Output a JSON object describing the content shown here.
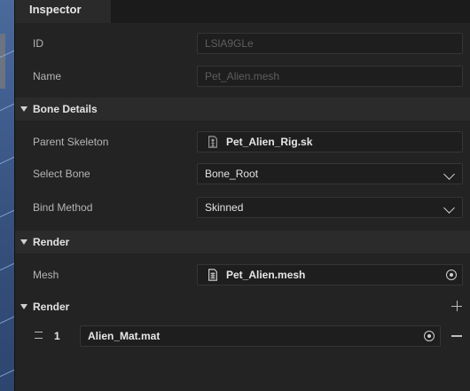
{
  "panel": {
    "tab_title": "Inspector"
  },
  "fields": {
    "id": {
      "label": "ID",
      "value": "LSlA9GLe"
    },
    "name": {
      "label": "Name",
      "value": "Pet_Alien.mesh"
    }
  },
  "bone_details": {
    "title": "Bone Details",
    "parent_skeleton": {
      "label": "Parent Skeleton",
      "value": "Pet_Alien_Rig.sk",
      "icon": "skeleton-file-icon"
    },
    "select_bone": {
      "label": "Select Bone",
      "value": "Bone_Root"
    },
    "bind_method": {
      "label": "Bind Method",
      "value": "Skinned"
    }
  },
  "render_mesh": {
    "title": "Render",
    "mesh": {
      "label": "Mesh",
      "value": "Pet_Alien.mesh",
      "icon": "mesh-grid-icon"
    }
  },
  "render_materials": {
    "title": "Render",
    "items": [
      {
        "index": "1",
        "material": "Alien_Mat.mat"
      }
    ]
  },
  "colors": {
    "background": "#232323",
    "section_header": "#2b2b2b",
    "field_bg": "#1e1e1e",
    "viewport": "#3f5d8e"
  }
}
